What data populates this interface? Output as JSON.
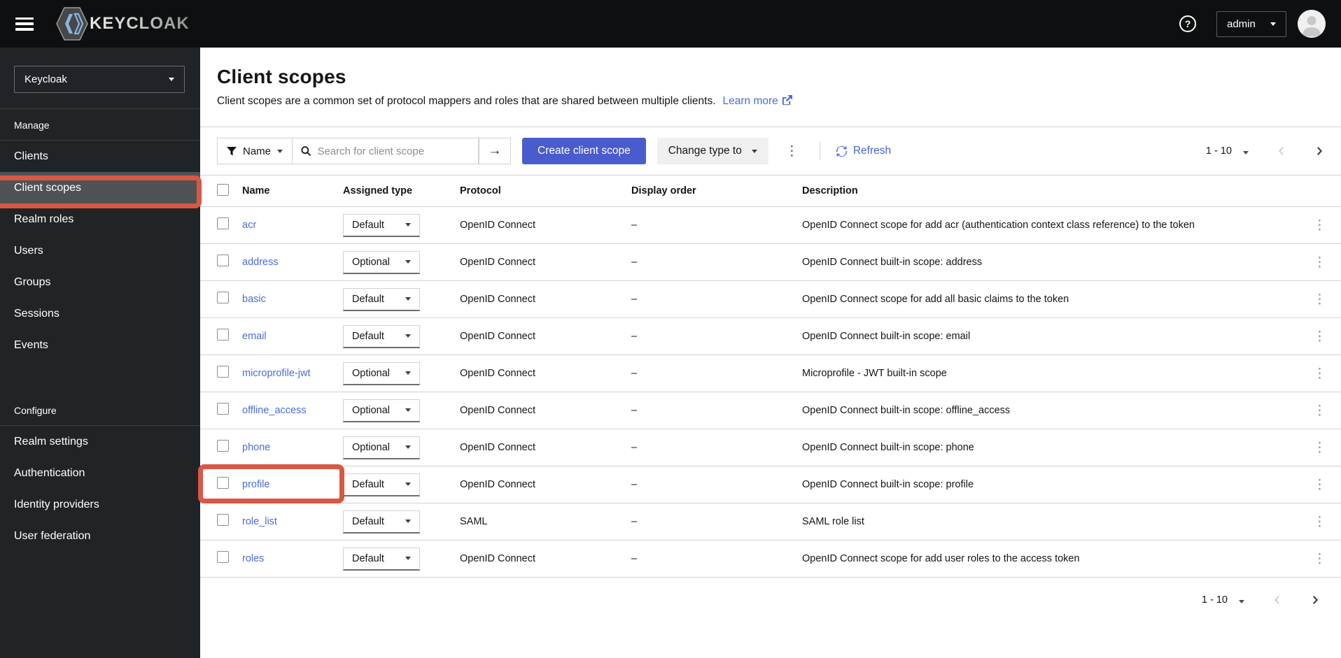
{
  "masthead": {
    "brand": "KEYCLOAK",
    "user": {
      "label": "admin"
    }
  },
  "sidebar": {
    "realm_selector": {
      "value": "Keycloak"
    },
    "selected_item": "Client scopes",
    "sections": [
      {
        "label": "Manage",
        "items": [
          "Clients",
          "Client scopes",
          "Realm roles",
          "Users",
          "Groups",
          "Sessions",
          "Events"
        ]
      },
      {
        "label": "Configure",
        "items": [
          "Realm settings",
          "Authentication",
          "Identity providers",
          "User federation"
        ]
      }
    ]
  },
  "page_header": {
    "title": "Client scopes",
    "description": "Client scopes are a common set of protocol mappers and roles that are shared between multiple clients.",
    "learn_more_label": "Learn more"
  },
  "toolbar": {
    "filter_label": "Name",
    "search_placeholder": "Search for client scope",
    "create_button_label": "Create client scope",
    "change_type_label": "Change type to",
    "refresh_label": "Refresh",
    "kebab_glyph": "⋮",
    "arrow_glyph": "→"
  },
  "pagination": {
    "range": "1 - 10"
  },
  "table": {
    "headers": [
      "Name",
      "Assigned type",
      "Protocol",
      "Display order",
      "Description"
    ],
    "rows": [
      {
        "name": "acr",
        "type": "Default",
        "protocol": "OpenID Connect",
        "display_order": "–",
        "description": "OpenID Connect scope for add acr (authentication context class reference) to the token"
      },
      {
        "name": "address",
        "type": "Optional",
        "protocol": "OpenID Connect",
        "display_order": "–",
        "description": "OpenID Connect built-in scope: address"
      },
      {
        "name": "basic",
        "type": "Default",
        "protocol": "OpenID Connect",
        "display_order": "–",
        "description": "OpenID Connect scope for add all basic claims to the token"
      },
      {
        "name": "email",
        "type": "Default",
        "protocol": "OpenID Connect",
        "display_order": "–",
        "description": "OpenID Connect built-in scope: email"
      },
      {
        "name": "microprofile-jwt",
        "type": "Optional",
        "protocol": "OpenID Connect",
        "display_order": "–",
        "description": "Microprofile - JWT built-in scope"
      },
      {
        "name": "offline_access",
        "type": "Optional",
        "protocol": "OpenID Connect",
        "display_order": "–",
        "description": "OpenID Connect built-in scope: offline_access"
      },
      {
        "name": "phone",
        "type": "Optional",
        "protocol": "OpenID Connect",
        "display_order": "–",
        "description": "OpenID Connect built-in scope: phone"
      },
      {
        "name": "profile",
        "type": "Default",
        "protocol": "OpenID Connect",
        "display_order": "–",
        "description": "OpenID Connect built-in scope: profile"
      },
      {
        "name": "role_list",
        "type": "Default",
        "protocol": "SAML",
        "display_order": "–",
        "description": "SAML role list"
      },
      {
        "name": "roles",
        "type": "Default",
        "protocol": "OpenID Connect",
        "display_order": "–",
        "description": "OpenID Connect scope for add user roles to the access token"
      }
    ]
  },
  "colors": {
    "annotation_red": "#d95745",
    "primary_blue": "#4a5bce",
    "link_blue": "#4a6cd9",
    "masthead_black": "#0e0f10",
    "sidebar_dark": "#212427"
  }
}
